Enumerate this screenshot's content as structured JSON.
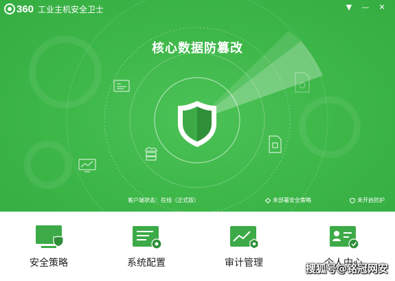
{
  "app": {
    "logo_text": "360",
    "title": "工业主机安全卫士"
  },
  "window_controls": {
    "menu_glyph": "▼",
    "minimize_glyph": "—",
    "close_glyph": "✕"
  },
  "hero": {
    "headline": "核心数据防篡改",
    "client_status": "客户端状态：在线（正式版）",
    "deploy_status": "未部署安全策略",
    "protect_status": "未开启防护"
  },
  "menu": [
    {
      "label": "安全策略",
      "icon": "monitor-shield-icon"
    },
    {
      "label": "系统配置",
      "icon": "config-gear-icon"
    },
    {
      "label": "审计管理",
      "icon": "audit-chart-icon"
    },
    {
      "label": "个人中心",
      "icon": "user-card-icon"
    }
  ],
  "watermark": "搜狐号@铭冠网安",
  "colors": {
    "hero_green": "#3fb84a",
    "icon_green": "#3daa48",
    "text": "#222222"
  }
}
